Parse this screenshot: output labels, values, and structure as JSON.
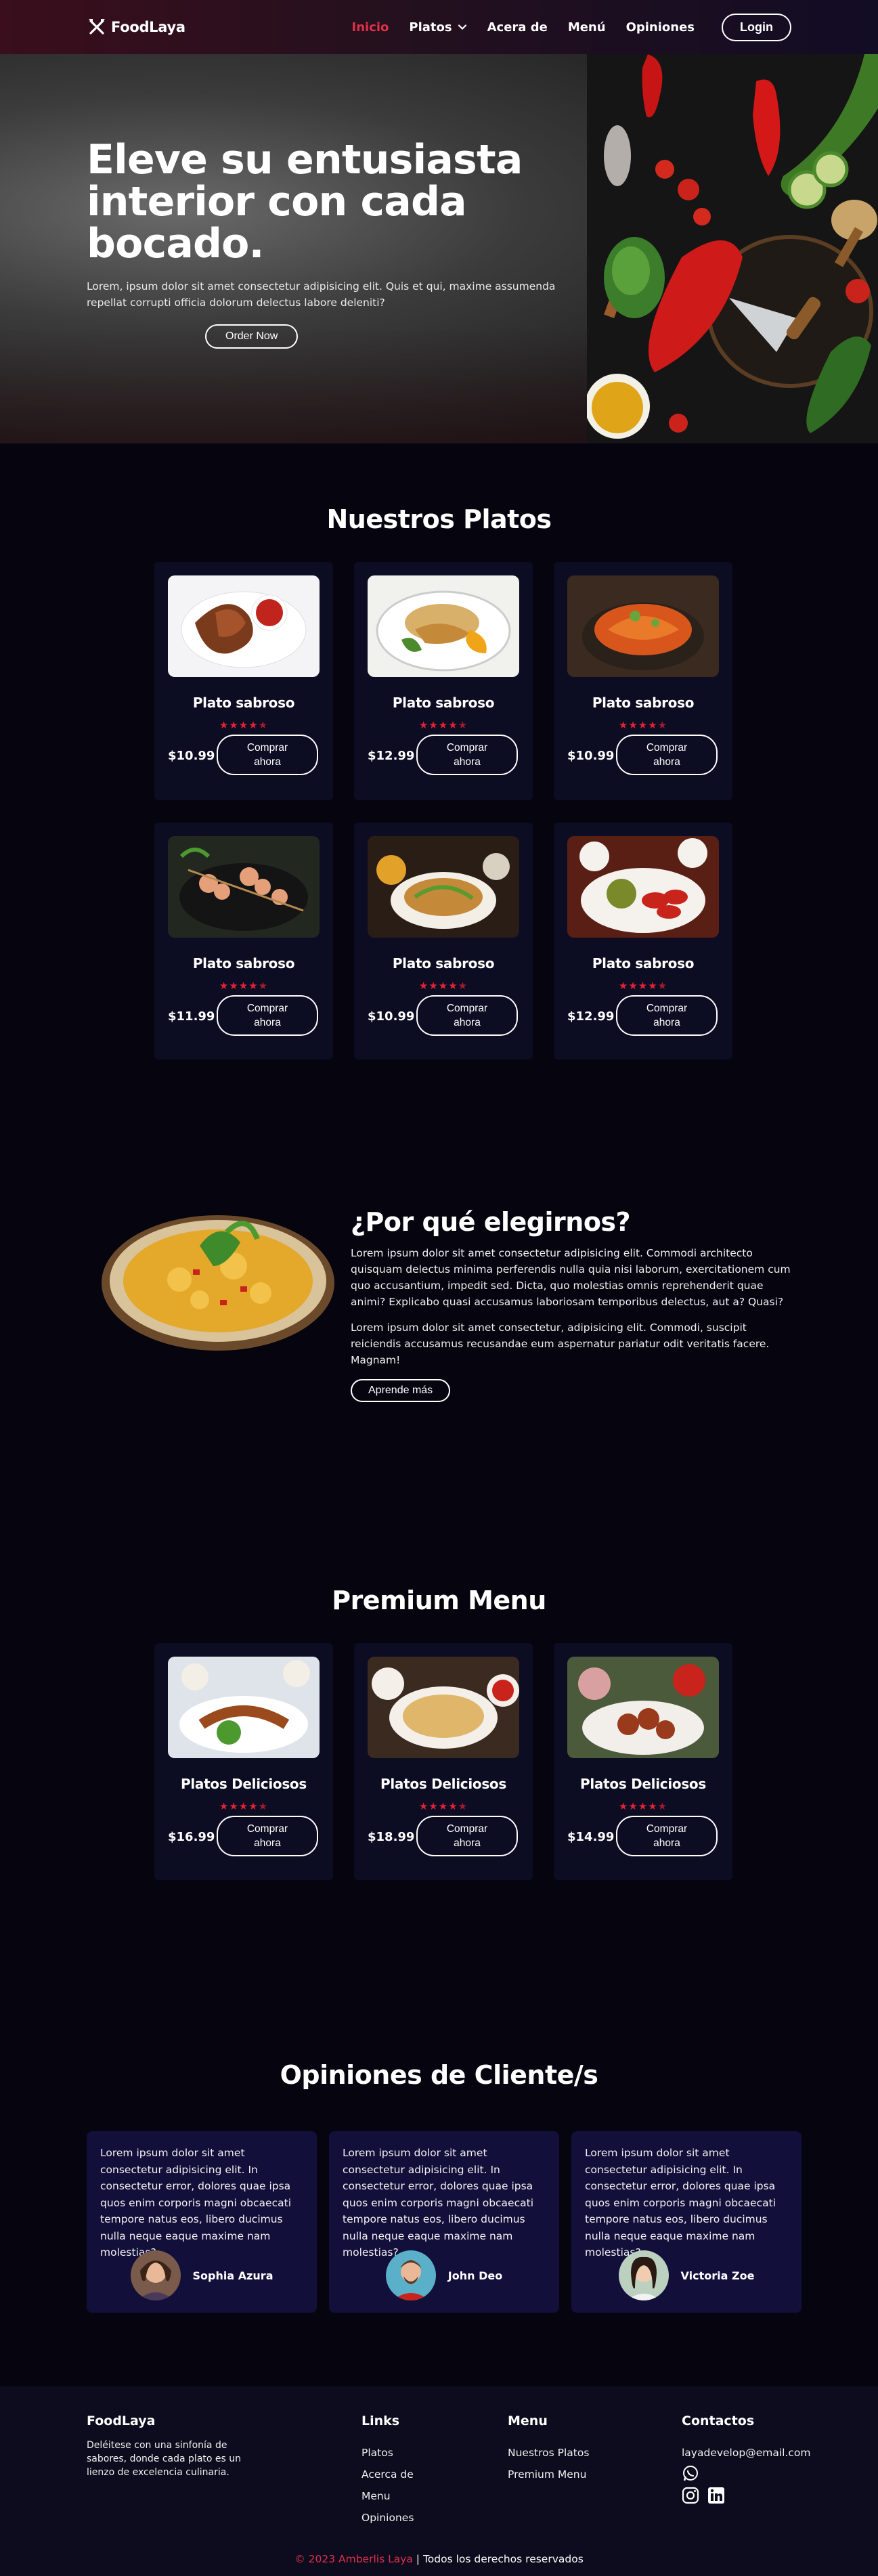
{
  "nav": {
    "brand": "FoodLaya",
    "links": [
      "Inicio",
      "Platos",
      "Acera de",
      "Menú",
      "Opiniones"
    ],
    "login": "Login"
  },
  "hero": {
    "title": "Eleve su entusiasta interior con cada bocado.",
    "subtitle": "Lorem, ipsum dolor sit amet consectetur adipisicing elit. Quis et qui, maxime assumenda repellat corrupti officia dolorum delectus labore deleniti?",
    "button": "Order Now"
  },
  "dishes": {
    "title": "Nuestros Platos",
    "items": [
      {
        "name": "Plato sabroso",
        "price": "$10.99",
        "button": "Comprar ahora",
        "rating": 4.5
      },
      {
        "name": "Plato sabroso",
        "price": "$12.99",
        "button": "Comprar ahora",
        "rating": 4.5
      },
      {
        "name": "Plato sabroso",
        "price": "$10.99",
        "button": "Comprar ahora",
        "rating": 4.5
      },
      {
        "name": "Plato sabroso",
        "price": "$11.99",
        "button": "Comprar ahora",
        "rating": 4.5
      },
      {
        "name": "Plato sabroso",
        "price": "$10.99",
        "button": "Comprar ahora",
        "rating": 4.5
      },
      {
        "name": "Plato sabroso",
        "price": "$12.99",
        "button": "Comprar ahora",
        "rating": 4.5
      }
    ]
  },
  "why": {
    "title": "¿Por qué elegirnos?",
    "p1": "Lorem ipsum dolor sit amet consectetur adipisicing elit. Commodi architecto quisquam delectus minima perferendis nulla quia nisi laborum, exercitationem cum quo accusantium, impedit sed. Dicta, quo molestias omnis reprehenderit quae animi? Explicabo quasi accusamus laboriosam temporibus delectus, aut a? Quasi?",
    "p2": "Lorem ipsum dolor sit amet consectetur, adipisicing elit. Commodi, suscipit reiciendis accusamus recusandae eum aspernatur pariatur odit veritatis facere. Magnam!",
    "button": "Aprende más"
  },
  "premium": {
    "title": "Premium Menu",
    "items": [
      {
        "name": "Platos Deliciosos",
        "price": "$16.99",
        "button": "Comprar ahora",
        "rating": 4.5
      },
      {
        "name": "Platos Deliciosos",
        "price": "$18.99",
        "button": "Comprar ahora",
        "rating": 4.5
      },
      {
        "name": "Platos Deliciosos",
        "price": "$14.99",
        "button": "Comprar ahora",
        "rating": 4.5
      }
    ]
  },
  "testimonials": {
    "title": "Opiniones de Cliente/s",
    "items": [
      {
        "text": "Lorem ipsum dolor sit amet consectetur adipisicing elit. In consectetur error, dolores quae ipsa quos enim corporis magni obcaecati tempore natus eos, libero ducimus nulla neque eaque maxime nam molestias?",
        "name": "Sophia Azura"
      },
      {
        "text": "Lorem ipsum dolor sit amet consectetur adipisicing elit. In consectetur error, dolores quae ipsa quos enim corporis magni obcaecati tempore natus eos, libero ducimus nulla neque eaque maxime nam molestias?",
        "name": "John Deo"
      },
      {
        "text": "Lorem ipsum dolor sit amet consectetur adipisicing elit. In consectetur error, dolores quae ipsa quos enim corporis magni obcaecati tempore natus eos, libero ducimus nulla neque eaque maxime nam molestias?",
        "name": "Victoria Zoe"
      }
    ]
  },
  "footer": {
    "brand": "FoodLaya",
    "description": "Deléitese con una sinfonía de sabores, donde cada plato es un lienzo de excelencia culinaria.",
    "links_title": "Links",
    "links": [
      "Platos",
      "Acerca de",
      "Menu",
      "Opiniones"
    ],
    "menu_title": "Menu",
    "menu": [
      "Nuestros Platos",
      "Premium Menu"
    ],
    "contact_title": "Contactos",
    "email": "layadevelop@email.com",
    "copyright": "© 2023 Amberlis Laya",
    "rights": " | Todos los derechos reservados"
  },
  "colors": {
    "accent": "#e0304a",
    "background": "#05040f",
    "card": "#0c0c22",
    "testimonial_card": "#12103a",
    "stars": "#e32236"
  },
  "icons": [
    "utensils-logo-icon",
    "chevron-down-icon",
    "star-icon",
    "whatsapp-icon",
    "instagram-icon",
    "linkedin-icon"
  ]
}
